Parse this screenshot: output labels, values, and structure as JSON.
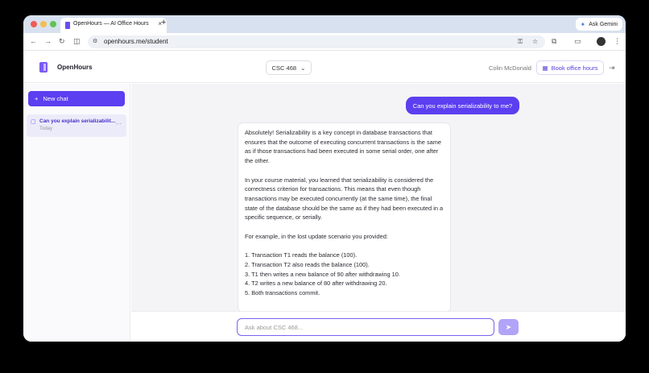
{
  "browser": {
    "tab_title": "OpenHours — AI Office Hours",
    "tab_close": "×",
    "new_tab": "+",
    "ask_gemini": "Ask Gemini",
    "url": "openhours.me/student"
  },
  "header": {
    "brand": "OpenHours",
    "course": "CSC 468",
    "user_name": "Colin McDonald",
    "book_button": "Book office hours"
  },
  "sidebar": {
    "new_chat": "New chat",
    "chats": [
      {
        "title": "Can you explain serializabilit...",
        "date": "Today"
      }
    ]
  },
  "conversation": {
    "user_message": "Can you explain serializability to me?",
    "assistant_paragraphs": [
      "Absolutely! Serializability is a key concept in database transactions that ensures that the outcome of executing concurrent transactions is the same as if those transactions had been executed in some serial order, one after the other.",
      "In your course material, you learned that serializability is considered the correctness criterion for transactions. This means that even though transactions may be executed concurrently (at the same time), the final state of the database should be the same as if they had been executed in a specific sequence, or serially.",
      "For example, in the lost update scenario you provided:"
    ],
    "assistant_list": [
      "1. Transaction T1 reads the balance (100).",
      "2. Transaction T2 also reads the balance (100).",
      "3. T1 then writes a new balance of 90 after withdrawing 10.",
      "4. T2 writes a new balance of 80 after withdrawing 20.",
      "5. Both transactions commit."
    ]
  },
  "composer": {
    "placeholder": "Ask about CSC 468..."
  },
  "colors": {
    "accent": "#5b3ff0",
    "accent_light": "#b1a3f7"
  }
}
